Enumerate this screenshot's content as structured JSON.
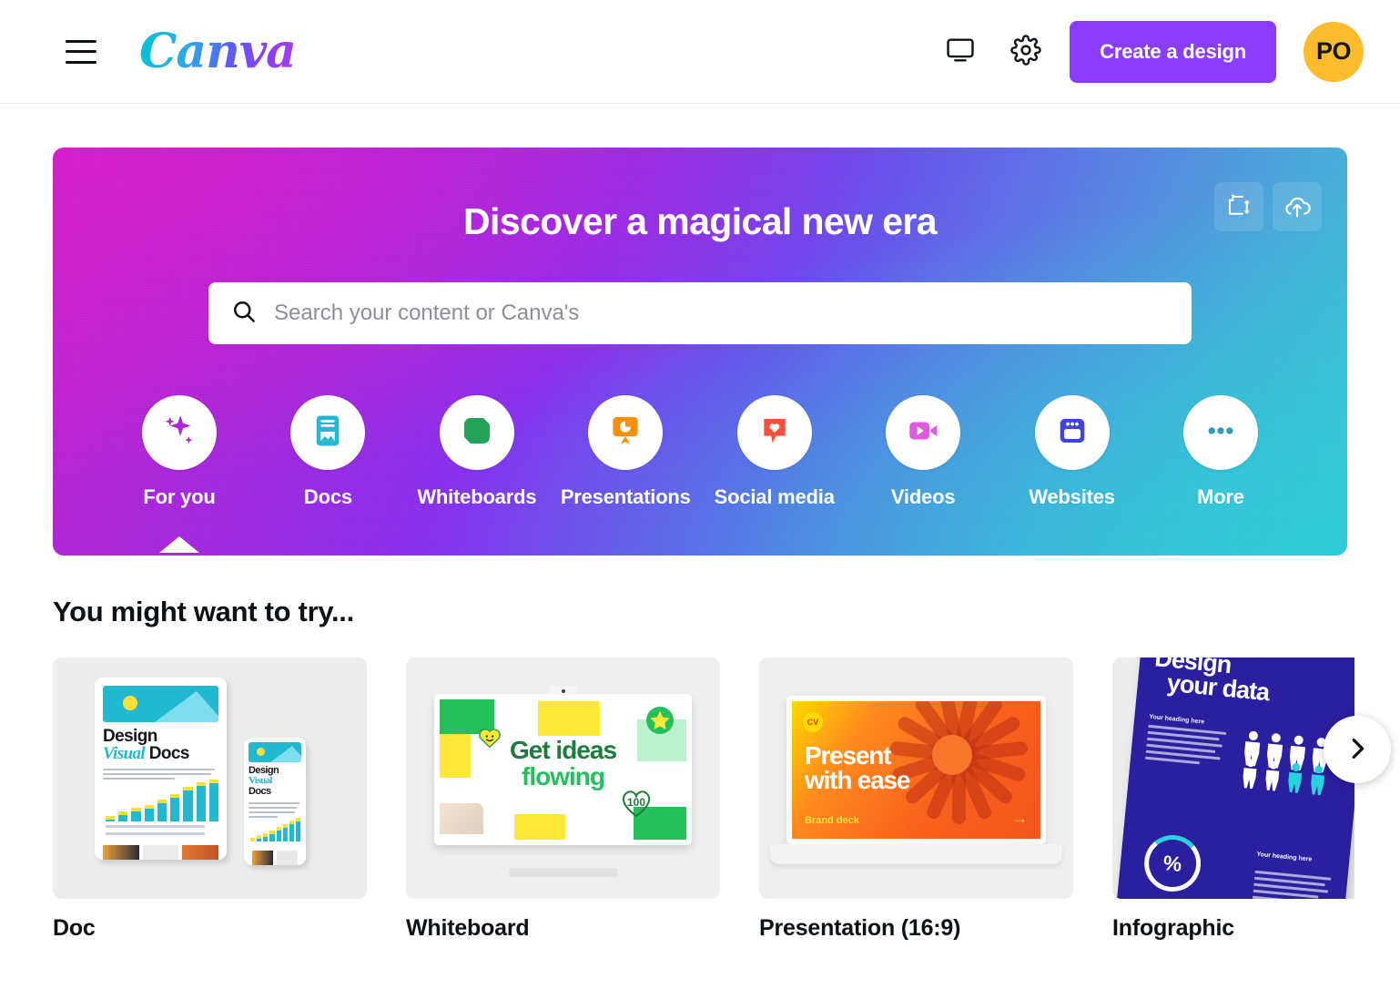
{
  "header": {
    "menu_icon": "hamburger-icon",
    "brand": "Canva",
    "display_icon": "monitor-icon",
    "settings_icon": "gear-icon",
    "create_label": "Create a design",
    "avatar_initials": "PO",
    "accent_purple": "#8b3dff",
    "avatar_bg": "#fcbc2d"
  },
  "hero": {
    "title": "Discover a magical new era",
    "resize_icon": "custom-size-icon",
    "upload_icon": "cloud-upload-icon",
    "gradient_start": "#c622c9",
    "gradient_mid": "#6a49ef",
    "gradient_end": "#3cc8d8",
    "search": {
      "icon": "search-icon",
      "placeholder": "Search your content or Canva's",
      "value": ""
    },
    "categories": [
      {
        "label": "For you",
        "icon": "sparkles-icon",
        "color": "#b224d6",
        "active": true
      },
      {
        "label": "Docs",
        "icon": "document-icon",
        "color": "#22b8cf",
        "active": false
      },
      {
        "label": "Whiteboards",
        "icon": "whiteboard-icon",
        "color": "#23a35a",
        "active": false
      },
      {
        "label": "Presentations",
        "icon": "presentation-icon",
        "color": "#f5900c",
        "active": false
      },
      {
        "label": "Social media",
        "icon": "heart-bubble-icon",
        "color": "#f4503c",
        "active": false
      },
      {
        "label": "Videos",
        "icon": "video-camera-icon",
        "color": "#e05ae0",
        "active": false
      },
      {
        "label": "Websites",
        "icon": "browser-window-icon",
        "color": "#3f44e0",
        "active": false
      },
      {
        "label": "More",
        "icon": "ellipsis-icon",
        "color": "#2f9db5",
        "active": false
      }
    ]
  },
  "suggestions": {
    "heading": "You might want to try...",
    "next_icon": "chevron-right-icon",
    "cards": [
      {
        "label": "Doc",
        "art": {
          "type": "doc-devices",
          "title_line1": "Design",
          "title_line2_italic": "Visual",
          "title_line2_rest": "Docs",
          "accent": "#22b8cf",
          "bar_accent": "#ffe03a"
        }
      },
      {
        "label": "Whiteboard",
        "art": {
          "type": "whiteboard-monitor",
          "title_line1": "Get ideas",
          "title_line2": "flowing",
          "sticker_smiley": "smiley-heart-sticker",
          "sticker_star": "star-badge-sticker",
          "sticker_hundred": "100",
          "green_dark": "#1e7b3c",
          "green": "#25c05c",
          "yellow": "#ffe83a"
        }
      },
      {
        "label": "Presentation (16:9)",
        "art": {
          "type": "laptop-slide",
          "title_line1": "Present",
          "title_line2": "with ease",
          "footer_label": "Brand deck",
          "arrow": "→",
          "accent": "#f2571b",
          "highlight": "#ffd900"
        }
      },
      {
        "label": "Infographic",
        "art": {
          "type": "infographic-poster",
          "title_line1": "Design",
          "title_line2": "your data",
          "heading_1": "Your heading here",
          "heading_2": "Your heading here",
          "percent_symbol": "%",
          "bg": "#2a1f9e",
          "accent": "#29d1e0"
        }
      }
    ]
  }
}
